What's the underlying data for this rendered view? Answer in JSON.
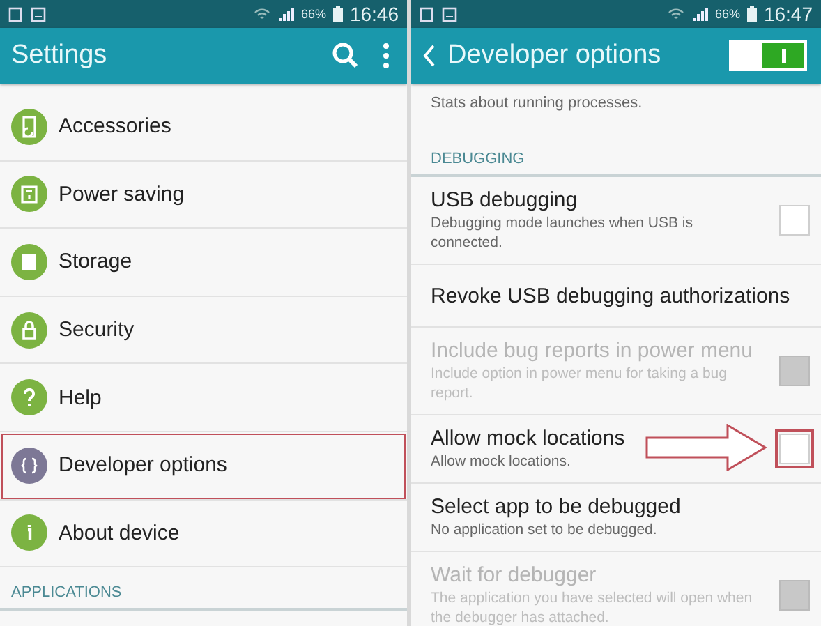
{
  "left_screen": {
    "status_bar": {
      "battery": "66%",
      "time": "16:46"
    },
    "app_bar": {
      "title": "Settings"
    },
    "items": [
      {
        "label": "Accessories",
        "color": "#7cb342",
        "highlighted": false
      },
      {
        "label": "Power saving",
        "color": "#7cb342",
        "highlighted": false
      },
      {
        "label": "Storage",
        "color": "#7cb342",
        "highlighted": false
      },
      {
        "label": "Security",
        "color": "#7cb342",
        "highlighted": false
      },
      {
        "label": "Help",
        "color": "#7cb342",
        "highlighted": false
      },
      {
        "label": "Developer options",
        "color": "#7d7896",
        "highlighted": true
      },
      {
        "label": "About device",
        "color": "#7cb342",
        "highlighted": false
      }
    ],
    "section_header": "APPLICATIONS"
  },
  "right_screen": {
    "status_bar": {
      "battery": "66%",
      "time": "16:47"
    },
    "app_bar": {
      "title": "Developer options",
      "on": true
    },
    "top_subtitle": "Stats about running processes.",
    "section_header": "DEBUGGING",
    "options": [
      {
        "kind": "checkbox",
        "title": "USB debugging",
        "subtitle": "Debugging mode launches when USB is connected.",
        "checked": false,
        "disabled": false,
        "highlighted": false
      },
      {
        "kind": "plain",
        "title": "Revoke USB debugging authorizations",
        "disabled": false,
        "highlighted": false
      },
      {
        "kind": "checkbox",
        "title": "Include bug reports in power menu",
        "subtitle": "Include option in power menu for taking a bug report.",
        "checked": false,
        "disabled": true,
        "highlighted": false
      },
      {
        "kind": "checkbox",
        "title": "Allow mock locations",
        "subtitle": "Allow mock locations.",
        "checked": false,
        "disabled": false,
        "highlighted": true
      },
      {
        "kind": "plain",
        "title": "Select app to be debugged",
        "subtitle": "No application set to be debugged.",
        "disabled": false,
        "highlighted": false
      },
      {
        "kind": "checkbox",
        "title": "Wait for debugger",
        "subtitle": "The application you have selected will open when the debugger has attached.",
        "checked": false,
        "disabled": true,
        "highlighted": false
      }
    ]
  }
}
